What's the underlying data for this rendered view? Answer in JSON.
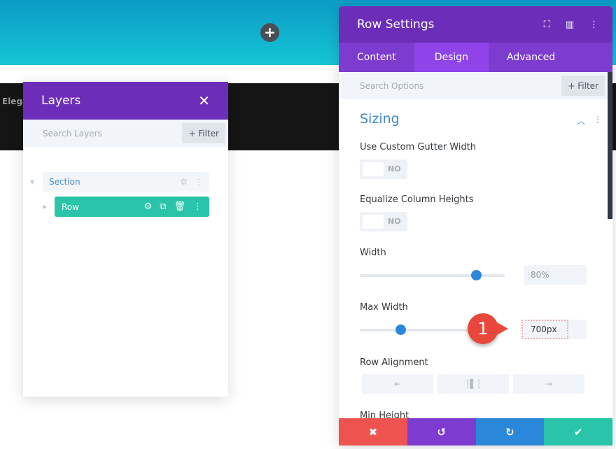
{
  "background": {
    "partial_text": "Elega",
    "add_icon": "plus-icon"
  },
  "layers": {
    "title": "Layers",
    "search_placeholder": "Search Layers",
    "filter_label": "+ Filter",
    "tree": [
      {
        "label": "Section"
      },
      {
        "label": "Row"
      }
    ]
  },
  "settings": {
    "title": "Row Settings",
    "tabs": [
      {
        "label": "Content"
      },
      {
        "label": "Design",
        "active": true
      },
      {
        "label": "Advanced"
      }
    ],
    "search_placeholder": "Search Options",
    "filter_label": "+ Filter",
    "group": "Sizing",
    "fields": {
      "gutter": {
        "label": "Use Custom Gutter Width",
        "value": "NO"
      },
      "equalize": {
        "label": "Equalize Column Heights",
        "value": "NO"
      },
      "width": {
        "label": "Width",
        "value": "80%",
        "slider_percent": 80
      },
      "max_width": {
        "label": "Max Width",
        "value": "700px",
        "slider_percent": 28
      },
      "row_alignment": {
        "label": "Row Alignment",
        "options": [
          "left",
          "center",
          "right"
        ]
      },
      "min_height": {
        "label": "Min Height"
      }
    },
    "footer": [
      "discard",
      "undo",
      "redo",
      "save"
    ]
  },
  "annotation": {
    "number": "1",
    "color": "#e9473b"
  },
  "colors": {
    "purple": "#6c2eb9",
    "teal": "#29c4a9",
    "blue": "#2b87da",
    "red": "#ef5350"
  }
}
